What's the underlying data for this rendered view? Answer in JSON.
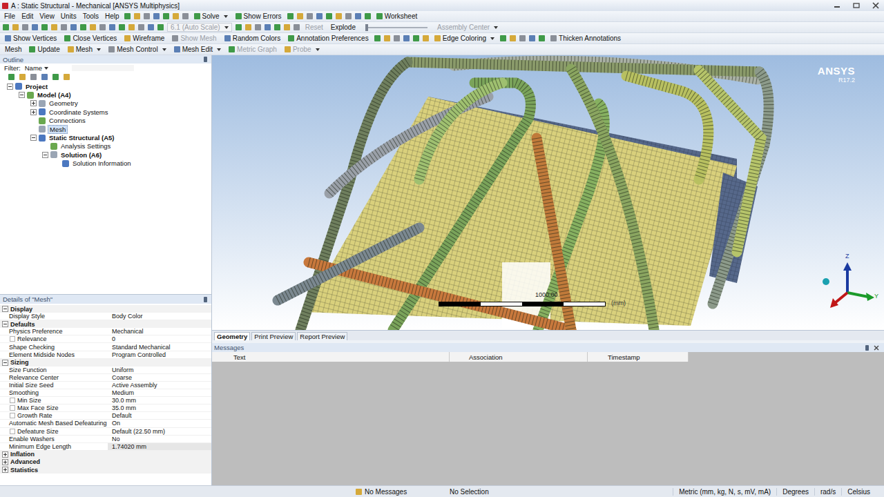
{
  "window": {
    "title": "A : Static Structural - Mechanical [ANSYS Multiphysics]"
  },
  "menu": [
    "File",
    "Edit",
    "View",
    "Units",
    "Tools",
    "Help"
  ],
  "toolbar_main": [
    {
      "label": "Solve",
      "disabled": false,
      "dropdown": true
    },
    {
      "label": "Show Errors",
      "disabled": false,
      "dropdown": false
    },
    {
      "label": "Worksheet",
      "disabled": false,
      "dropdown": false
    }
  ],
  "toolbar_graphics": [
    {
      "label": "6.1 (Auto Scale)",
      "disabled": true,
      "dropdown": true
    },
    {
      "label": "Reset",
      "disabled": true,
      "dropdown": false
    },
    {
      "label": "Explode",
      "disabled": false,
      "dropdown": false
    },
    {
      "label": "Assembly Center",
      "disabled": true,
      "dropdown": true
    }
  ],
  "toolbar_view": [
    {
      "label": "Show Vertices",
      "disabled": false,
      "dropdown": false
    },
    {
      "label": "Close Vertices",
      "disabled": false,
      "dropdown": false
    },
    {
      "label": "Wireframe",
      "disabled": false,
      "dropdown": false
    },
    {
      "label": "Show Mesh",
      "disabled": true,
      "dropdown": false
    },
    {
      "label": "Random Colors",
      "disabled": false,
      "dropdown": false
    },
    {
      "label": "Annotation Preferences",
      "disabled": false,
      "dropdown": false
    },
    {
      "label": "Edge Coloring",
      "disabled": false,
      "dropdown": true
    },
    {
      "label": "Thicken Annotations",
      "disabled": false,
      "dropdown": false
    }
  ],
  "toolbar_context": [
    {
      "label": "Mesh",
      "disabled": false,
      "dropdown": false
    },
    {
      "label": "Update",
      "disabled": false,
      "dropdown": false
    },
    {
      "label": "Mesh",
      "disabled": false,
      "dropdown": true
    },
    {
      "label": "Mesh Control",
      "disabled": false,
      "dropdown": true
    },
    {
      "label": "Mesh Edit",
      "disabled": false,
      "dropdown": true
    },
    {
      "label": "Metric Graph",
      "disabled": true,
      "dropdown": false
    },
    {
      "label": "Probe",
      "disabled": true,
      "dropdown": true
    }
  ],
  "outline": {
    "title": "Outline",
    "filter_label": "Filter:",
    "filter_value": "Name",
    "tree": [
      {
        "label": "Project",
        "depth": 0,
        "expandable": true,
        "expanded": true,
        "selected": false,
        "bold": true
      },
      {
        "label": "Model (A4)",
        "depth": 1,
        "expandable": true,
        "expanded": true,
        "selected": false,
        "bold": true
      },
      {
        "label": "Geometry",
        "depth": 2,
        "expandable": true,
        "expanded": false,
        "selected": false,
        "bold": false
      },
      {
        "label": "Coordinate Systems",
        "depth": 2,
        "expandable": true,
        "expanded": false,
        "selected": false,
        "bold": false
      },
      {
        "label": "Connections",
        "depth": 2,
        "expandable": false,
        "expanded": false,
        "selected": false,
        "bold": false
      },
      {
        "label": "Mesh",
        "depth": 2,
        "expandable": false,
        "expanded": false,
        "selected": true,
        "bold": false
      },
      {
        "label": "Static Structural (A5)",
        "depth": 2,
        "expandable": true,
        "expanded": true,
        "selected": false,
        "bold": true
      },
      {
        "label": "Analysis Settings",
        "depth": 3,
        "expandable": false,
        "expanded": false,
        "selected": false,
        "bold": false
      },
      {
        "label": "Solution (A6)",
        "depth": 3,
        "expandable": true,
        "expanded": true,
        "selected": false,
        "bold": true
      },
      {
        "label": "Solution Information",
        "depth": 4,
        "expandable": false,
        "expanded": false,
        "selected": false,
        "bold": false
      }
    ]
  },
  "details": {
    "title": "Details of \"Mesh\"",
    "groups": [
      {
        "name": "Display",
        "expanded": true,
        "rows": [
          {
            "label": "Display Style",
            "value": "Body Color",
            "indent": false,
            "readonly": false
          }
        ]
      },
      {
        "name": "Defaults",
        "expanded": true,
        "rows": [
          {
            "label": "Physics Preference",
            "value": "Mechanical",
            "indent": false,
            "readonly": false
          },
          {
            "label": "Relevance",
            "value": "0",
            "indent": true,
            "readonly": false
          },
          {
            "label": "Shape Checking",
            "value": "Standard Mechanical",
            "indent": false,
            "readonly": false
          },
          {
            "label": "Element Midside Nodes",
            "value": "Program Controlled",
            "indent": false,
            "readonly": false
          }
        ]
      },
      {
        "name": "Sizing",
        "expanded": true,
        "rows": [
          {
            "label": "Size Function",
            "value": "Uniform",
            "indent": false,
            "readonly": false
          },
          {
            "label": "Relevance Center",
            "value": "Coarse",
            "indent": false,
            "readonly": false
          },
          {
            "label": "Initial Size Seed",
            "value": "Active Assembly",
            "indent": false,
            "readonly": false
          },
          {
            "label": "Smoothing",
            "value": "Medium",
            "indent": false,
            "readonly": false
          },
          {
            "label": "Min Size",
            "value": "30.0 mm",
            "indent": true,
            "readonly": false
          },
          {
            "label": "Max Face Size",
            "value": "35.0 mm",
            "indent": true,
            "readonly": false
          },
          {
            "label": "Growth Rate",
            "value": "Default",
            "indent": true,
            "readonly": false
          },
          {
            "label": "Automatic Mesh Based Defeaturing",
            "value": "On",
            "indent": false,
            "readonly": false
          },
          {
            "label": "Defeature Size",
            "value": "Default (22.50 mm)",
            "indent": true,
            "readonly": false
          },
          {
            "label": "Enable Washers",
            "value": "No",
            "indent": false,
            "readonly": false
          },
          {
            "label": "Minimum Edge Length",
            "value": "1.74020 mm",
            "indent": false,
            "readonly": true
          }
        ]
      },
      {
        "name": "Inflation",
        "expanded": false,
        "rows": []
      },
      {
        "name": "Advanced",
        "expanded": false,
        "rows": []
      },
      {
        "name": "Statistics",
        "expanded": false,
        "rows": []
      }
    ]
  },
  "viewport": {
    "logo": "ANSYS",
    "version": "R17.2",
    "scale_value": "1000.00",
    "scale_units": "(mm)",
    "axes": [
      "Z",
      "Y"
    ]
  },
  "tabs": [
    {
      "label": "Geometry",
      "selected": true
    },
    {
      "label": "Print Preview",
      "selected": false
    },
    {
      "label": "Report Preview",
      "selected": false
    }
  ],
  "messages": {
    "title": "Messages",
    "columns": [
      "Text",
      "Association",
      "Timestamp"
    ]
  },
  "status_bar": {
    "messages": "No Messages",
    "selection": "No Selection",
    "units": "Metric (mm, kg, N, s, mV, mA)",
    "angle": "Degrees",
    "rotational": "rad/s",
    "temperature": "Celsius"
  }
}
